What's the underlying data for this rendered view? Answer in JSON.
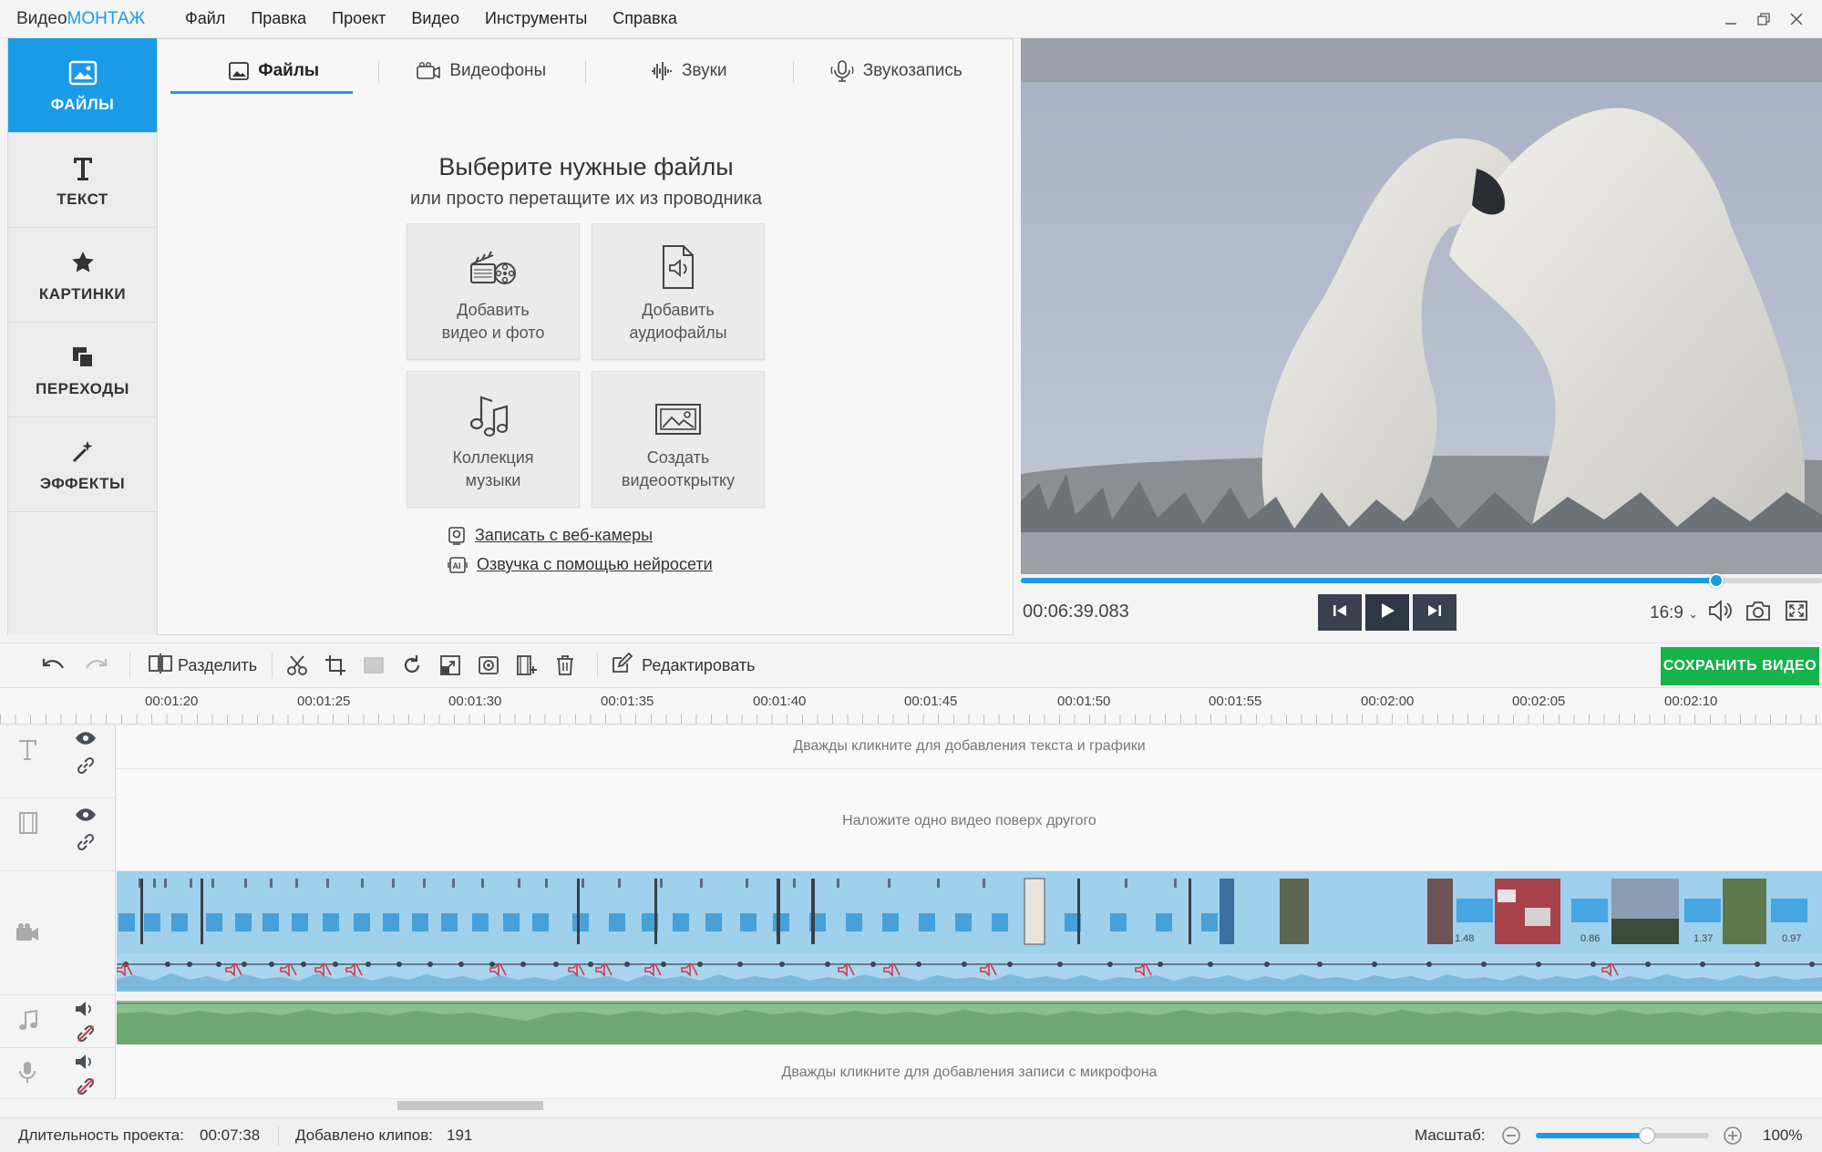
{
  "app": {
    "logo_prefix": "Видео",
    "logo_suffix": "МОНТАЖ"
  },
  "menu": [
    "Файл",
    "Правка",
    "Проект",
    "Видео",
    "Инструменты",
    "Справка"
  ],
  "window_controls": [
    "minimize-icon",
    "restore-icon",
    "close-icon"
  ],
  "sidebar": {
    "items": [
      {
        "label": "ФАЙЛЫ",
        "icon": "image-icon",
        "active": true
      },
      {
        "label": "ТЕКСТ",
        "icon": "text-icon",
        "active": false
      },
      {
        "label": "КАРТИНКИ",
        "icon": "star-icon",
        "active": false
      },
      {
        "label": "ПЕРЕХОДЫ",
        "icon": "transitions-icon",
        "active": false
      },
      {
        "label": "ЭФФЕКТЫ",
        "icon": "magic-wand-icon",
        "active": false
      }
    ]
  },
  "files_panel": {
    "tabs": [
      {
        "label": "Файлы",
        "icon": "image-icon",
        "active": true
      },
      {
        "label": "Видеофоны",
        "icon": "camera-icon",
        "active": false
      },
      {
        "label": "Звуки",
        "icon": "waveform-icon",
        "active": false
      },
      {
        "label": "Звукозапись",
        "icon": "microphone-icon",
        "active": false
      }
    ],
    "title": "Выберите нужные файлы",
    "subtitle": "или просто перетащите их из проводника",
    "tiles": [
      {
        "label": "Добавить\nвидео и фото",
        "icon": "film-camera-icon"
      },
      {
        "label": "Добавить\nаудиофайлы",
        "icon": "audio-file-icon"
      },
      {
        "label": "Коллекция\nмузыки",
        "icon": "music-notes-icon"
      },
      {
        "label": "Создать\nвидеооткрытку",
        "icon": "picture-frame-icon"
      }
    ],
    "links": [
      {
        "label": "Записать с веб-камеры",
        "icon": "webcam-icon"
      },
      {
        "label": "Озвучка с помощью нейросети",
        "icon": "ai-voice-icon"
      }
    ]
  },
  "preview": {
    "timecode": "00:06:39.083",
    "progress": 0.868,
    "aspect": "16:9"
  },
  "toolbar": {
    "split_label": "Разделить",
    "edit_label": "Редактировать",
    "save_label": "СОХРАНИТЬ ВИДЕО"
  },
  "ruler": {
    "labels": [
      "00:01:20",
      "00:01:25",
      "00:01:30",
      "00:01:35",
      "00:01:40",
      "00:01:45",
      "00:01:50",
      "00:01:55",
      "00:02:00",
      "00:02:05",
      "00:02:10"
    ]
  },
  "tracks": {
    "text_hint": "Дважды кликните для добавления текста и графики",
    "overlay_hint": "Наложите одно видео поверх другого",
    "mic_hint": "Дважды кликните для добавления записи с микрофона",
    "clip_durations": [
      "1.48",
      "0.86",
      "1.37",
      "0.97"
    ]
  },
  "status": {
    "duration_label": "Длительность проекта:",
    "duration_value": "00:07:38",
    "clips_label": "Добавлено клипов:",
    "clips_value": "191",
    "zoom_label": "Масштаб:",
    "zoom_value": "100%",
    "zoom_level": 0.64
  },
  "colors": {
    "accent": "#1a9be8",
    "save": "#16b24a",
    "video_track": "#9fd0ec",
    "music_track": "#8bbf8d"
  }
}
